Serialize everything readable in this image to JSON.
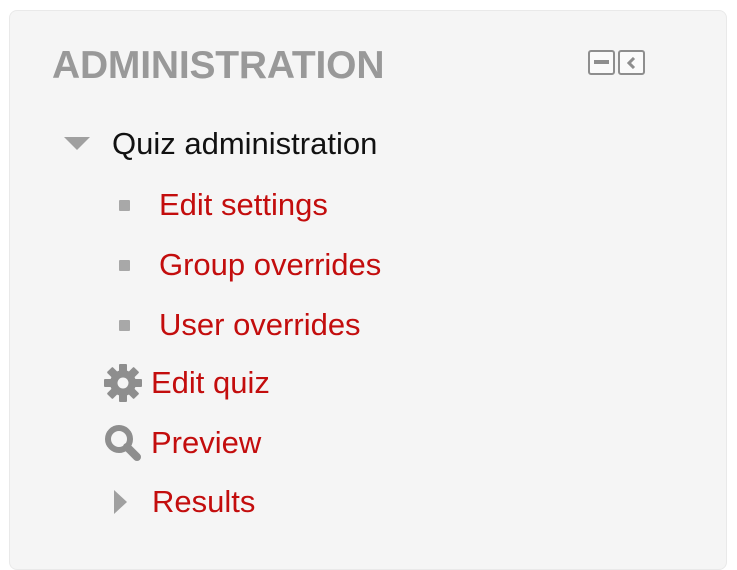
{
  "block": {
    "title": "ADMINISTRATION",
    "controls": [
      {
        "name": "collapse-block",
        "icon": "minus-icon"
      },
      {
        "name": "dock-block",
        "icon": "chevron-left-icon"
      }
    ]
  },
  "tree": {
    "root": {
      "label": "Quiz administration",
      "icon": "caret-down-icon",
      "expanded": true
    },
    "children": [
      {
        "label": "Edit settings",
        "icon": "bullet-icon"
      },
      {
        "label": "Group overrides",
        "icon": "bullet-icon"
      },
      {
        "label": "User overrides",
        "icon": "bullet-icon"
      }
    ],
    "items": [
      {
        "label": "Edit quiz",
        "icon": "gear-icon"
      },
      {
        "label": "Preview",
        "icon": "magnifier-icon"
      },
      {
        "label": "Results",
        "icon": "caret-right-icon",
        "expanded": false
      }
    ]
  },
  "colors": {
    "link": "#c30d0d",
    "title": "#999999",
    "icon": "#8e8e8e",
    "background": "#f5f5f5"
  }
}
